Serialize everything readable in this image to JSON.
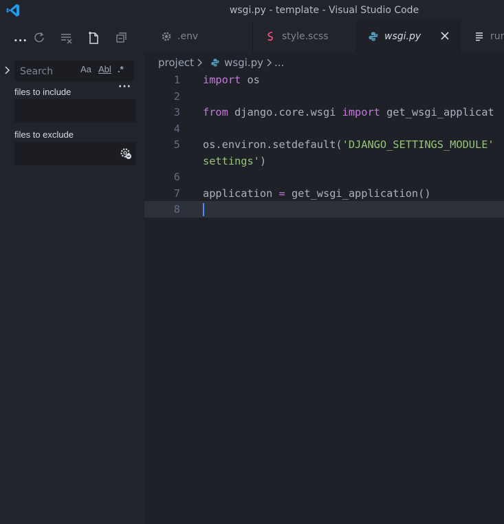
{
  "window": {
    "title": "wsgi.py - template - Visual Studio Code",
    "logo_icon": "vscode-logo-icon"
  },
  "sidebar": {
    "more_actions": "...",
    "toolbar_icons": [
      "refresh-icon",
      "clear-results-icon",
      "new-search-editor-icon",
      "collapse-all-icon"
    ],
    "search": {
      "placeholder": "Search",
      "value": "",
      "match_case": "Aa",
      "whole_word": "Abl",
      "regex": ".*"
    },
    "details_dots": "···",
    "files_to_include": {
      "label": "files to include",
      "value": ""
    },
    "files_to_exclude": {
      "label": "files to exclude",
      "value": ""
    }
  },
  "tabs": [
    {
      "label": ".env",
      "icon": "gear-icon",
      "active": false
    },
    {
      "label": "style.scss",
      "icon": "sass-icon",
      "active": false
    },
    {
      "label": "wsgi.py",
      "icon": "python-icon",
      "active": true
    },
    {
      "label": "run",
      "icon": "text-file-icon",
      "active": false
    }
  ],
  "breadcrumb": {
    "folder": "project",
    "file": "wsgi.py",
    "more": "..."
  },
  "editor": {
    "lines": [
      {
        "num": "1",
        "tokens": [
          [
            "kw",
            "import"
          ],
          [
            "t",
            " os"
          ]
        ]
      },
      {
        "num": "2",
        "tokens": []
      },
      {
        "num": "3",
        "tokens": [
          [
            "kw",
            "from"
          ],
          [
            "t",
            " django.core.wsgi "
          ],
          [
            "kw",
            "import"
          ],
          [
            "t",
            " get_wsgi_applicat"
          ]
        ]
      },
      {
        "num": "4",
        "tokens": []
      },
      {
        "num": "5",
        "tokens": [
          [
            "t",
            "os.environ.setdefault("
          ],
          [
            "str",
            "'DJANGO_SETTINGS_MODULE'"
          ]
        ]
      },
      {
        "num": "",
        "tokens": [
          [
            "str",
            "settings'"
          ],
          [
            "t",
            ")"
          ]
        ]
      },
      {
        "num": "6",
        "tokens": []
      },
      {
        "num": "7",
        "tokens": [
          [
            "t",
            "application "
          ],
          [
            "op",
            "="
          ],
          [
            "t",
            " get_wsgi_application()"
          ]
        ]
      },
      {
        "num": "8",
        "tokens": []
      }
    ],
    "colors": {
      "keyword": "#c678dd",
      "string": "#98c379",
      "text": "#abb2bf",
      "caret": "#528bff"
    }
  }
}
